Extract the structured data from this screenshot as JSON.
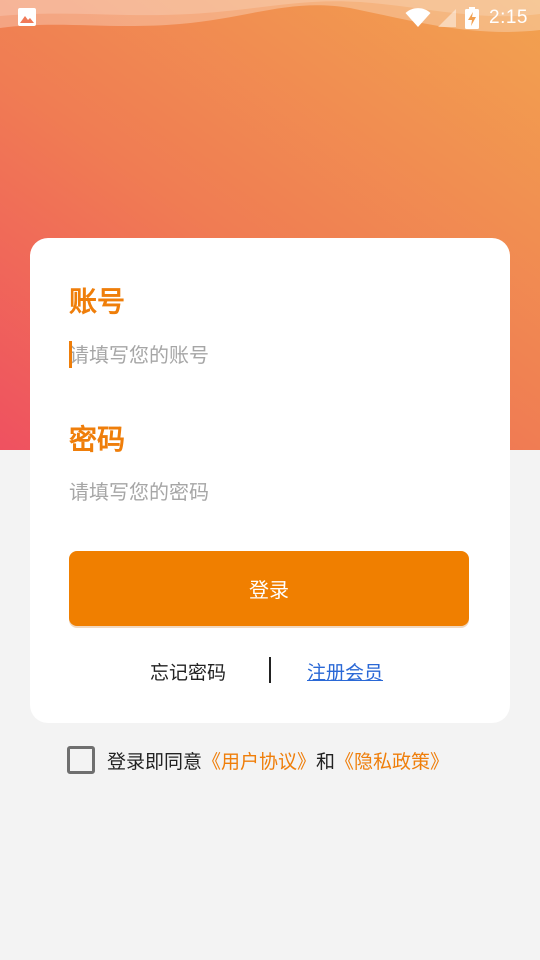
{
  "status_bar": {
    "time": "2:15",
    "icons": [
      "image-icon",
      "wifi-icon",
      "signal-icon",
      "battery-charging-icon"
    ]
  },
  "form": {
    "account_label": "账号",
    "account_placeholder": "请填写您的账号",
    "account_value": "",
    "password_label": "密码",
    "password_placeholder": "请填写您的密码",
    "password_value": "",
    "login_button": "登录",
    "forgot_password": "忘记密码",
    "register": "注册会员"
  },
  "agreement": {
    "prefix": "登录即同意",
    "user_agreement": "《用户协议》",
    "conjunction": "和",
    "privacy_policy": "《隐私政策》",
    "checked": false
  },
  "colors": {
    "accent": "#f07f00",
    "label": "#ef7e0a",
    "link": "#2a68d6",
    "gradient_start": "#ef5160",
    "gradient_end": "#f2a24f",
    "background": "#f3f3f3"
  }
}
